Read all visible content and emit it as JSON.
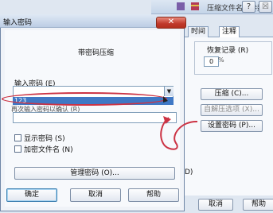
{
  "background_dialog": {
    "title": "压缩文件名和参数",
    "help_glyph": "?",
    "close_glyph": "☒",
    "tabs": [
      "时间",
      "注释"
    ],
    "recovery_label": "恢复记录 (R)",
    "recovery_value": "0",
    "recovery_unit": "%",
    "compression_button": "压缩 (C)...",
    "auto_unzip_button": "自解压选项 (X)...",
    "set_password_button": "设置密码 (P)...",
    "side_text": "D)",
    "cancel_button": "取消",
    "help_button": "帮助"
  },
  "password_dialog": {
    "title": "输入密码",
    "close_glyph": "✕",
    "heading": "带密码压缩",
    "input_label": "输入密码 (E)",
    "dropdown_item": "123",
    "confirm_label": "再次输入密码以确认 (R)",
    "show_password_label": "显示密码 (S)",
    "encrypt_filenames_label": "加密文件名 (N)",
    "manage_passwords_button": "管理密码 (O)...",
    "ok_button": "确定",
    "cancel_button": "取消",
    "help_button": "帮助"
  },
  "colors": {
    "annotation": "#cc3344",
    "selection": "#3f78c5",
    "close_button": "#c0392b"
  }
}
